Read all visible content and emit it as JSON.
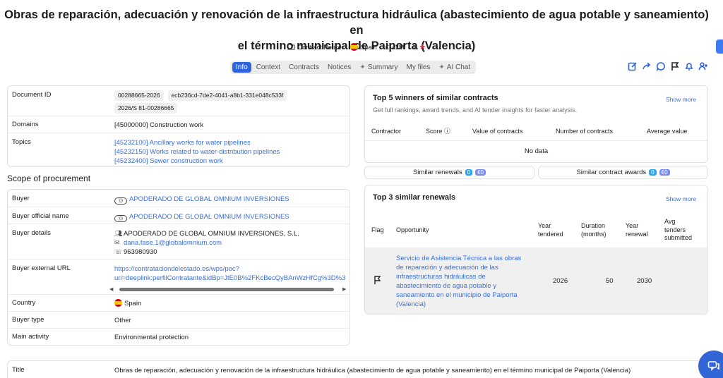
{
  "header": {
    "title_line1": "Obras de reparación, adecuación y renovación de la infraestructura hidráulica (abastecimiento de agua potable y saneamiento) en",
    "title_line2": "el término municipal de Paiporta (Valencia)",
    "notice_type": "Contract Notice",
    "country": "Spain",
    "value": "42M",
    "rating": "1"
  },
  "tabs": [
    "Info",
    "Context",
    "Contracts",
    "Notices",
    "Summary",
    "My files",
    "AI Chat"
  ],
  "details": {
    "document_id_label": "Document ID",
    "document_ids": [
      "00288665-2026",
      "ecb236cd-7de2-4041-a8b1-331e048c533f",
      "2026/S 81-00286665"
    ],
    "domains_label": "Domains",
    "domains": [
      "[45000000] Construction work"
    ],
    "topics_label": "Topics",
    "topics": [
      "[45232100] Ancillary works for water pipelines",
      "[45232150] Works related to water-distribution pipelines",
      "[45232400] Sewer construction work"
    ]
  },
  "scope": {
    "heading": "Scope of procurement",
    "buyer_label": "Buyer",
    "buyer": "APODERADO DE GLOBAL OMNIUM INVERSIONES",
    "buyer_official_label": "Buyer official name",
    "buyer_official": "APODERADO DE GLOBAL OMNIUM INVERSIONES",
    "buyer_details_label": "Buyer details",
    "buyer_details_name": "APODERADO DE GLOBAL OMNIUM INVERSIONES, S.L.",
    "buyer_details_email": "dana.fase.1@globalomnium.com",
    "buyer_details_phone": "963980930",
    "buyer_url_label": "Buyer external URL",
    "buyer_url_line1": "https://contrataciondelestado.es/wps/poc?",
    "buyer_url_line2": "uri=deeplink:perfilContratante&idBp=JtE0B%2FKcBecQyBAnWzHfCg%3D%3",
    "country_label": "Country",
    "country": "Spain",
    "buyer_type_label": "Buyer type",
    "buyer_type": "Other",
    "main_activity_label": "Main activity",
    "main_activity": "Environmental protection"
  },
  "winners": {
    "title": "Top 5 winners of similar contracts",
    "subtitle": "Get full rankings, award trends, and AI tender insights for faster analysis.",
    "show_more": "Show more",
    "columns": [
      "Contractor",
      "Score",
      "Value of contracts",
      "Number of contracts",
      "Average value"
    ],
    "empty": "No data"
  },
  "pills": {
    "renewals_label": "Similar renewals",
    "renewals_count": "0",
    "renewals_value": "€0",
    "awards_label": "Similar contract awards",
    "awards_count": "0",
    "awards_value": "€0"
  },
  "renewals": {
    "title": "Top 3 similar renewals",
    "show_more": "Show more",
    "col_flag": "Flag",
    "col_opportunity": "Opportunity",
    "col_year_tendered_1": "Year",
    "col_year_tendered_2": "tendered",
    "col_duration_1": "Duration",
    "col_duration_2": "(months)",
    "col_year_renewal_1": "Year",
    "col_year_renewal_2": "renewal",
    "col_avg_1": "Avg",
    "col_avg_2": "tenders",
    "col_avg_3": "submitted",
    "row": {
      "opportunity_lines": [
        "Servicio de Asistencia Técnica a las obras",
        "de reparación y adecuación de las",
        "infraestructuras hidráulicas de",
        "abastecimiento de agua potable y",
        "saneamiento en el municipio de Paiporta",
        "(Valencia)"
      ],
      "year_tendered": "2026",
      "duration": "50",
      "year_renewal": "2030"
    }
  },
  "bottom": {
    "title_label": "Title",
    "title_value": "Obras de reparación, adecuación y renovación de la infraestructura hidráulica (abastecimiento de agua potable y saneamiento) en el término municipal de Paiporta (Valencia)"
  }
}
